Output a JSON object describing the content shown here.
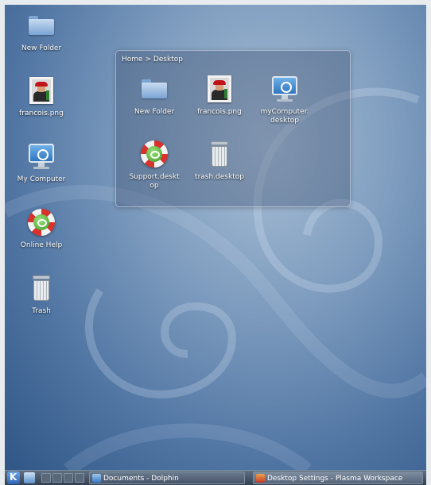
{
  "desktop_icons": [
    {
      "label": "New Folder",
      "icon": "folder-icon"
    },
    {
      "label": "francois.png",
      "icon": "image-icon"
    },
    {
      "label": "My Computer",
      "icon": "computer-icon"
    },
    {
      "label": "Online Help",
      "icon": "help-icon"
    },
    {
      "label": "Trash",
      "icon": "trash-icon"
    }
  ],
  "folder_view": {
    "breadcrumb": "Home > Desktop",
    "items": [
      {
        "label": "New Folder",
        "icon": "folder-icon"
      },
      {
        "label": "francois.png",
        "icon": "image-icon"
      },
      {
        "label": "myComputer.\ndesktop",
        "icon": "computer-icon"
      },
      {
        "label": "Support.deskt\nop",
        "icon": "help-icon"
      },
      {
        "label": "trash.desktop",
        "icon": "trash-icon"
      }
    ]
  },
  "taskbar": {
    "kmenu_icon": "kde-logo-icon",
    "tasks": [
      {
        "label": "Documents - Dolphin",
        "icon": "dolphin-icon"
      },
      {
        "label": "Desktop Settings - Plasma Workspace",
        "icon": "settings-icon"
      }
    ]
  },
  "colors": {
    "wallpaper": "#4f74a2",
    "panel": "#34404f"
  }
}
